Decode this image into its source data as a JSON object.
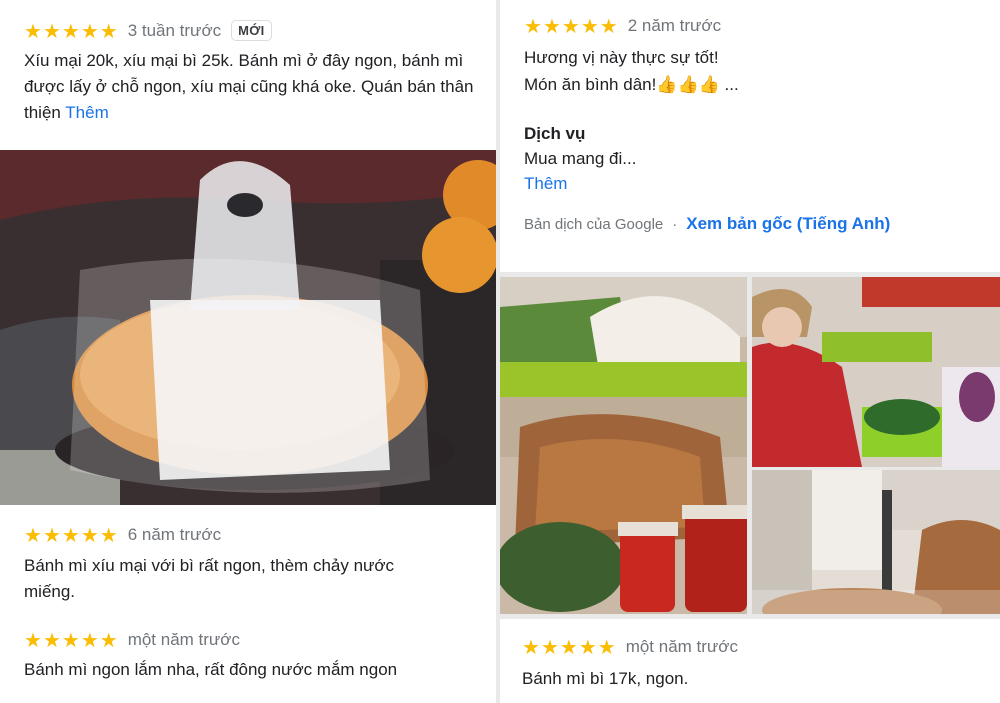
{
  "rating_stars": 5,
  "review1": {
    "when": "3 tuần trước",
    "badge": "MỚI",
    "text": "Xíu mại 20k, xíu mại bì 25k. Bánh mì ở đây ngon, bánh mì được lấy ở chỗ ngon, xíu mại cũng khá oke. Quán bán thân thiện",
    "more": "Thêm"
  },
  "review2": {
    "when": "2 năm trước",
    "line1": "Hương vị này thực sự tốt!",
    "line2": "Món ăn bình dân!👍👍👍 ...",
    "service_heading": "Dịch vụ",
    "service_text": "Mua mang đi...",
    "more": "Thêm",
    "translated_by": "Bản dịch của Google",
    "separator": "·",
    "see_original": "Xem bản gốc (Tiếng Anh)"
  },
  "review3": {
    "when": "6 năm trước",
    "text": "Bánh mì xíu mại với bì rất ngon, thèm chảy nước miếng."
  },
  "review4": {
    "when": "một năm trước",
    "text": "Bánh mì ngon lắm nha, rất đông nước mắm ngon"
  },
  "review5": {
    "when": "một năm trước",
    "text": "Bánh mì bì 17k, ngon."
  },
  "photos": {
    "bread_bag": "banh-mi-in-plastic-bag-on-scooter",
    "stall_ingredients": "food-stall-ingredients",
    "vendor": "vendor-preparing-food",
    "stall_counter": "stall-counter"
  },
  "colors": {
    "star": "#fbbc04",
    "link": "#1a73e8",
    "muted": "#70757a"
  }
}
